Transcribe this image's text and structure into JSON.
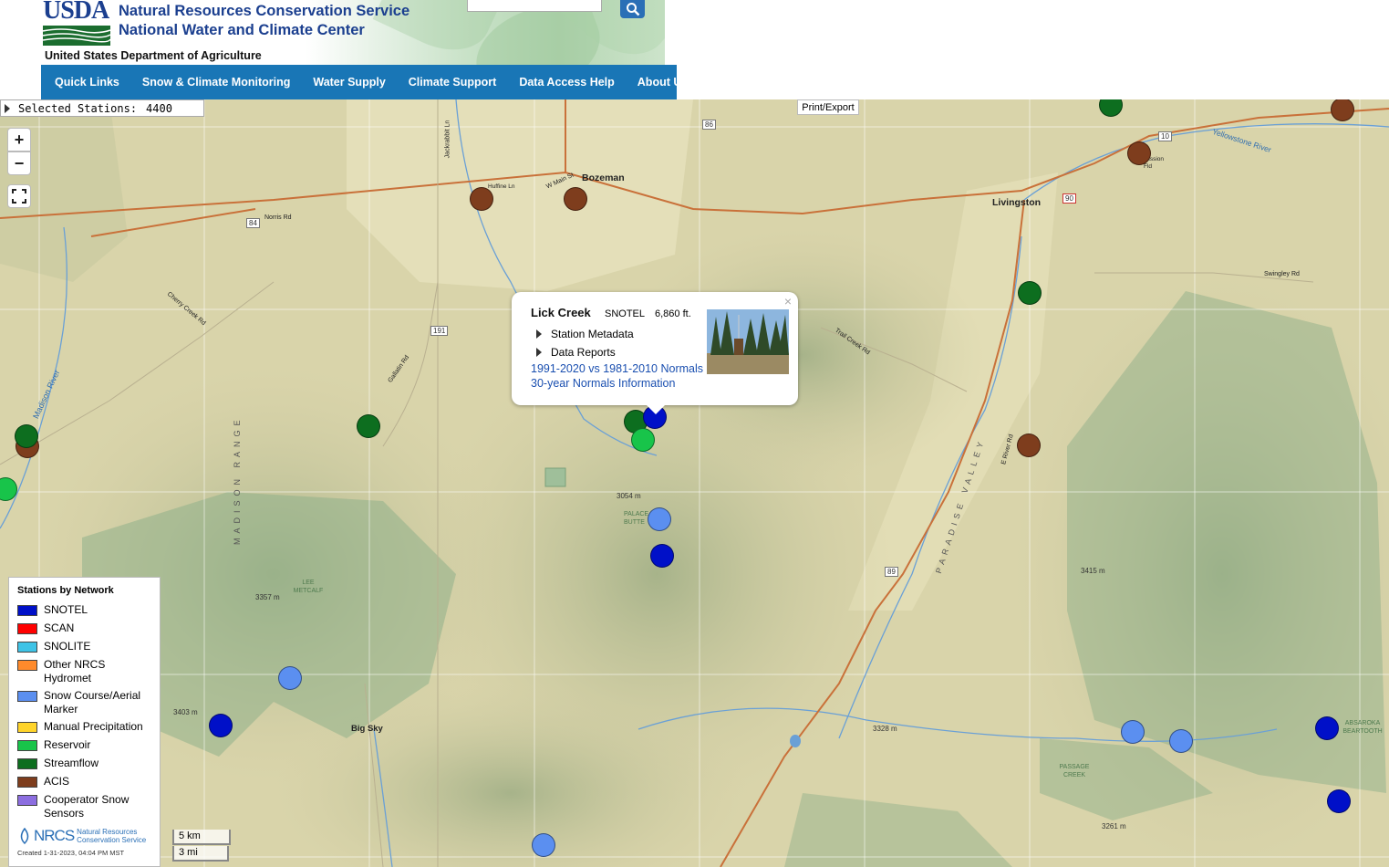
{
  "header": {
    "logo_text": "USDA",
    "agency_line1": "Natural Resources Conservation Service",
    "agency_line2": "National Water and Climate Center",
    "department": "United States Department of Agriculture",
    "search_placeholder": ""
  },
  "nav": [
    {
      "label": "Quick Links"
    },
    {
      "label": "Snow & Climate Monitoring"
    },
    {
      "label": "Water Supply"
    },
    {
      "label": "Climate Support"
    },
    {
      "label": "Data Access Help"
    },
    {
      "label": "About Us"
    }
  ],
  "map": {
    "selected_stations_label": "Selected Stations:",
    "selected_stations_count": "4400",
    "print_export": "Print/Export",
    "zoom_in": "+",
    "zoom_out": "−",
    "places": {
      "bozeman": "Bozeman",
      "livingston": "Livingston",
      "big_sky": "Big Sky",
      "main_st": "W Main St",
      "madison_range": "MADISON RANGE",
      "paradise_valley": "PARADISE VALLEY",
      "madison_river": "Madison River",
      "yellowstone_river": "Yellowstone River",
      "lee_metcalf": "LEE METCALF",
      "passage_creek": "PASSAGE CREEK",
      "absaroka": "ABSAROKA BEARTOOTH",
      "palace_butte": "PALACE BUTTE",
      "norris_rd": "Norris Rd",
      "cherry_creek_rd": "Cherry Creek Rd",
      "gallatin_rd": "Gallatin Rd",
      "jackrabbit_ln": "Jackrabbit Ln",
      "trail_creek_rd": "Trail Creek Rd",
      "swingley_rd": "Swingley Rd",
      "e_river_rd": "E River Rd",
      "mission_fld": "Mission Fld",
      "huffine_ln": "Huffine Ln",
      "elev_3054": "3054 m",
      "elev_3357": "3357 m",
      "elev_3403": "3403 m",
      "elev_3415": "3415 m",
      "elev_3328": "3328 m",
      "elev_3261": "3261 m",
      "hwy_84": "84",
      "hwy_86": "86",
      "hwy_191": "191",
      "hwy_89": "89",
      "hwy_90": "90",
      "hwy_10": "10"
    },
    "popup": {
      "station_name": "Lick Creek",
      "network": "SNOTEL",
      "elevation": "6,860 ft.",
      "rows": [
        "Station Metadata",
        "Data Reports"
      ],
      "link1": "1991-2020 vs 1981-2010 Normals",
      "link2": "30-year Normals Information"
    },
    "scale": {
      "km": "5 km",
      "mi": "3 mi"
    }
  },
  "legend": {
    "title": "Stations by Network",
    "items": [
      {
        "label": "SNOTEL",
        "color": "#0010c8"
      },
      {
        "label": "SCAN",
        "color": "#ff0000"
      },
      {
        "label": "SNOLITE",
        "color": "#3ec3e6"
      },
      {
        "label": "Other NRCS Hydromet",
        "color": "#ff8a2b"
      },
      {
        "label": "Snow Course/Aerial Marker",
        "color": "#5b8ff0"
      },
      {
        "label": "Manual Precipitation",
        "color": "#ffd42a"
      },
      {
        "label": "Reservoir",
        "color": "#18c44a"
      },
      {
        "label": "Streamflow",
        "color": "#0d6e1f"
      },
      {
        "label": "ACIS",
        "color": "#7e3d1d"
      },
      {
        "label": "Cooperator Snow Sensors",
        "color": "#8c6ee0"
      }
    ],
    "logo_word": "NRCS",
    "logo_sub1": "Natural Resources",
    "logo_sub2": "Conservation Service",
    "created": "Created 1-31-2023, 04:04 PM MST"
  },
  "stations": [
    {
      "type": "Streamflow",
      "color": "#0d6e1f"
    },
    {
      "type": "ACIS",
      "color": "#7e3d1d"
    }
  ]
}
